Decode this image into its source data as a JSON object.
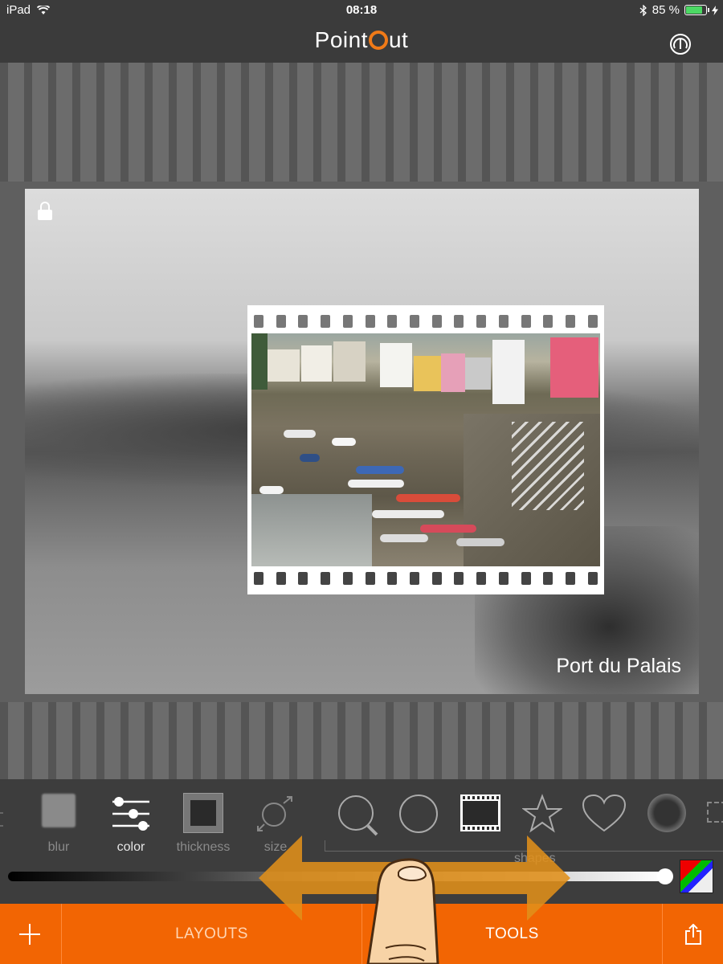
{
  "status_bar": {
    "device": "iPad",
    "time": "08:18",
    "battery": "85 %",
    "battery_level": 0.85
  },
  "header": {
    "logo_left": "Point",
    "logo_right": "ut",
    "help_icon": "help-icon"
  },
  "canvas": {
    "caption": "Port du Palais",
    "lock_icon": "unlocked-lock-icon",
    "frame_shape": "film"
  },
  "tools": {
    "items": [
      {
        "name": "blur",
        "label": "blur",
        "icon": "blur-square-icon"
      },
      {
        "name": "color",
        "label": "color",
        "icon": "sliders-icon",
        "active": true
      },
      {
        "name": "thickness",
        "label": "thickness",
        "icon": "thick-frame-icon"
      },
      {
        "name": "size",
        "label": "size",
        "icon": "resize-circle-icon"
      }
    ],
    "shapes_label": "shapes",
    "shapes": [
      "magnifier-icon",
      "circle-icon",
      "film-icon",
      "star-icon",
      "heart-icon",
      "vignette-circle-icon",
      "dashed-square-icon"
    ],
    "slider_value": 1.0
  },
  "tabbar": {
    "add_icon": "plus-icon",
    "layouts": "LAYOUTS",
    "tools": "TOOLS",
    "share_icon": "share-icon"
  },
  "colors": {
    "accent": "#f26503",
    "panel": "#3d3d3d",
    "logo_o": "#f07a18"
  }
}
